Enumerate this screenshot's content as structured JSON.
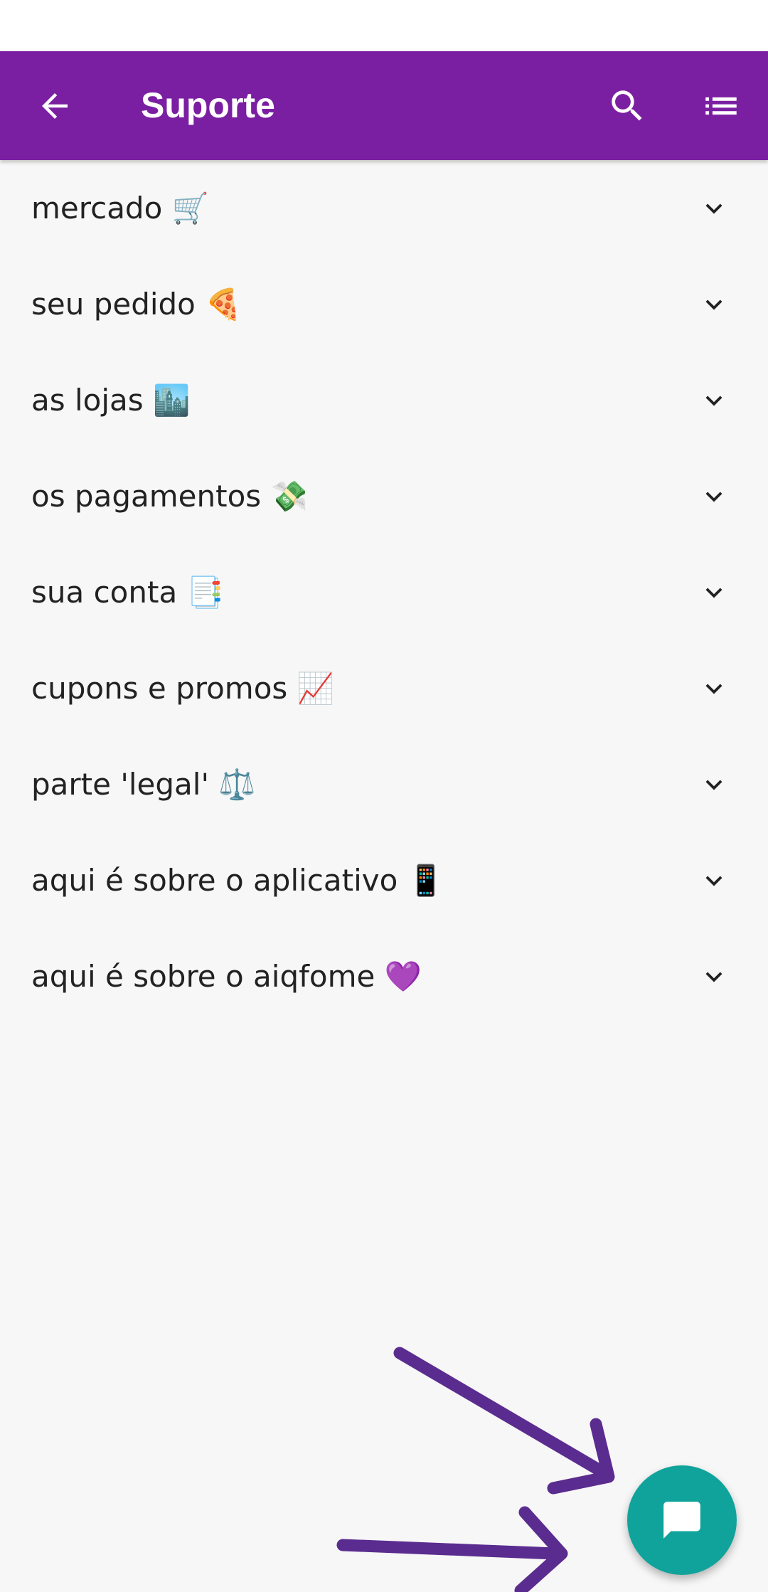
{
  "status_bar": {},
  "toolbar": {
    "title": "Suporte",
    "back_icon": "arrow-left-icon",
    "search_icon": "search-icon",
    "menu_icon": "list-icon",
    "color": "#7b1fa2"
  },
  "categories": [
    {
      "label": "mercado 🛒"
    },
    {
      "label": "seu pedido 🍕"
    },
    {
      "label": "as lojas 🏙️"
    },
    {
      "label": "os pagamentos 💸"
    },
    {
      "label": "sua conta 📑"
    },
    {
      "label": "cupons e promos 📈"
    },
    {
      "label": "parte 'legal' ⚖️"
    },
    {
      "label": "aqui é sobre o aplicativo 📱"
    },
    {
      "label": "aqui é sobre o aiqfome 💜"
    }
  ],
  "fab": {
    "icon": "chat-icon",
    "color": "#0fa39b"
  },
  "annotation": {
    "arrow_color": "#5b2c8f"
  }
}
